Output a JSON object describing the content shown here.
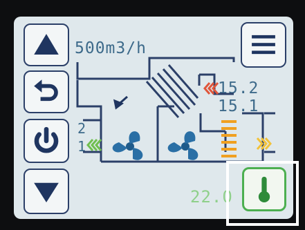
{
  "airflow": "500m3/h",
  "outdoor_temp": "15.2",
  "supply_temp": "15.1",
  "fan_speed_top": "2",
  "fan_speed_bottom": "1",
  "set_temp": "22.0",
  "icons": {
    "up": "triangle-up-icon",
    "back": "undo-icon",
    "power": "power-icon",
    "down": "triangle-down-icon",
    "menu": "hamburger-menu-icon",
    "temperature": "thermometer-icon"
  },
  "colors": {
    "line": "#2b3f68",
    "text": "#3d6a8a",
    "heat": "#e0553a",
    "warm": "#f0a020",
    "cool": "#6fbf4f",
    "accent": "#4caf50"
  }
}
